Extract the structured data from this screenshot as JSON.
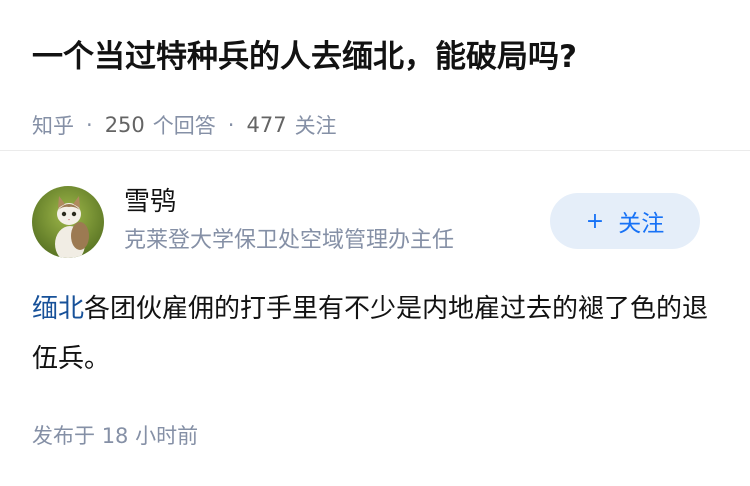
{
  "question": {
    "title": "一个当过特种兵的人去缅北，能破局吗?",
    "source": "知乎",
    "answer_count": "250",
    "answer_label": "个回答",
    "follow_count": "477",
    "follow_label": "关注",
    "separator": "·"
  },
  "author": {
    "name": "雪鸮",
    "headline": "克莱登大学保卫处空域管理办主任",
    "follow_button_label": "关注",
    "follow_button_icon": "plus-icon"
  },
  "answer": {
    "keyword": "缅北",
    "content_rest": "各团伙雇佣的打手里有不少是内地雇过去的褪了色的退伍兵。",
    "time_label": "发布于",
    "time_value": "18 小时前"
  },
  "colors": {
    "link": "#175199",
    "accent": "#1772f6",
    "muted": "#8590a6",
    "follow_bg": "#e5eef9"
  }
}
